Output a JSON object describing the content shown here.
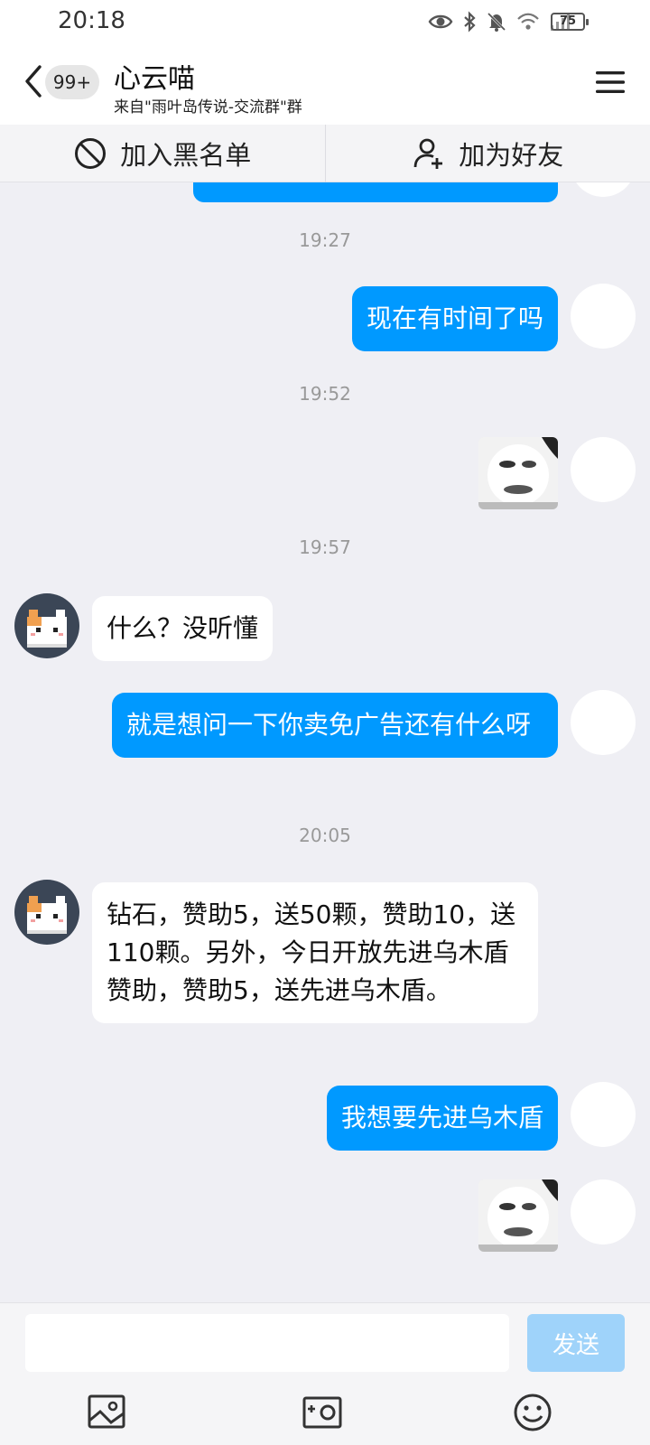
{
  "status_bar": {
    "time": "20:18",
    "battery": "75"
  },
  "header": {
    "unread_badge": "99+",
    "title": "心云喵",
    "subtitle": "来自\"雨叶岛传说-交流群\"群"
  },
  "actions": {
    "blacklist": "加入黑名单",
    "add_friend": "加为好友"
  },
  "messages": {
    "t1": "19:27",
    "m1": "现在有时间了吗",
    "t2": "19:52",
    "t3": "19:57",
    "m2": "什么？没听懂",
    "m3": "就是想问一下你卖免广告还有什么呀",
    "t4": "20:05",
    "m4": "钻石，赞助5，送50颗，赞助10，送110颗。另外，今日开放先进乌木盾赞助，赞助5，送先进乌木盾。",
    "m5": "我想要先进乌木盾"
  },
  "input": {
    "placeholder": "",
    "send_label": "发送"
  },
  "icons": {
    "back": "back-arrow-icon",
    "menu": "hamburger-menu-icon",
    "block": "block-icon",
    "add_friend": "add-person-icon",
    "image": "image-icon",
    "camera": "camera-icon",
    "emoji": "emoji-icon",
    "eye": "eye-icon",
    "bluetooth": "bluetooth-icon",
    "mute": "bell-muted-icon",
    "wifi": "wifi-icon",
    "signal": "signal-icon"
  },
  "colors": {
    "accent": "#0099ff",
    "send_disabled": "#9fd3fa",
    "background": "#efeff4"
  }
}
